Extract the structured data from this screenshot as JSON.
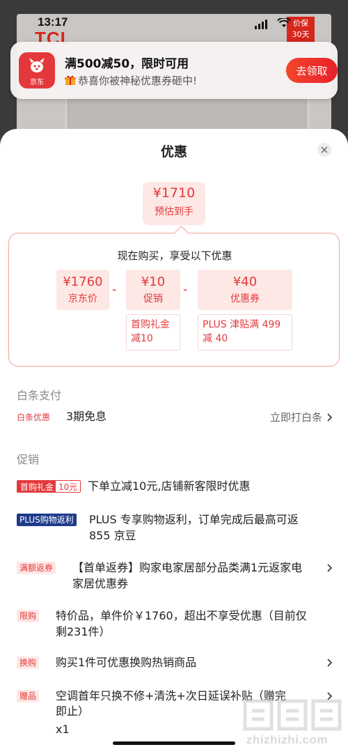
{
  "status_bar": {
    "time": "13:17"
  },
  "background_app": {
    "logo": "TCL",
    "badge_line1": "价保",
    "badge_line2": "30天"
  },
  "notification": {
    "app_name": "京东",
    "title": "满500减50，限时可用",
    "body": "恭喜你被神秘优惠券砸中!",
    "action_label": "去领取",
    "accent_color": "#e4393c"
  },
  "sheet": {
    "title": "优惠",
    "estimate": {
      "price": "¥1710",
      "label": "预估到手"
    },
    "calculation": {
      "heading": "现在购买，享受以下优惠",
      "items": [
        {
          "value": "¥1760",
          "label": "京东价"
        },
        {
          "value": "¥10",
          "label": "促销",
          "detail_line1": "首购礼金",
          "detail_line2": "减10"
        },
        {
          "value": "¥40",
          "label": "优惠券",
          "detail_line1": "PLUS 津贴满 499",
          "detail_line2": "减 40"
        }
      ],
      "operator": "-"
    },
    "baitiao": {
      "section_title": "白条支付",
      "tag": "白条优惠",
      "text": "3期免息",
      "link": "立即打白条"
    },
    "promotion": {
      "section_title": "促销",
      "rows": [
        {
          "tag": "首购礼金",
          "tag2": "10元",
          "line1": "下单立减10元,店铺新客限时优惠"
        },
        {
          "tag": "PLUS购物返利",
          "line1": "PLUS 专享购物返利，订单完成后最高可返",
          "line2": "855 京豆"
        },
        {
          "tag": "满额返券",
          "line1": "【首单返券】购家电家居部分品类满1元返家电",
          "line2": "家居优惠券"
        },
        {
          "tag": "限购",
          "line1": "特价品，单件价￥1760，超出不享受优惠（目前仅",
          "line2": "剩231件）"
        },
        {
          "tag": "换购",
          "line1": "购买1件可优惠换购热销商品"
        },
        {
          "tag": "赠品",
          "line1": "空调首年只换不修+清洗+次日延误补贴（赠完",
          "line2": "即止）",
          "line3": "x1"
        }
      ]
    }
  },
  "watermark": {
    "text": "zhizhizhi.com",
    "glyphs": "值值值"
  },
  "colors": {
    "brand_red": "#e4393c",
    "light_pink": "#fde8e5",
    "plus_blue": "#1e3b8a"
  }
}
